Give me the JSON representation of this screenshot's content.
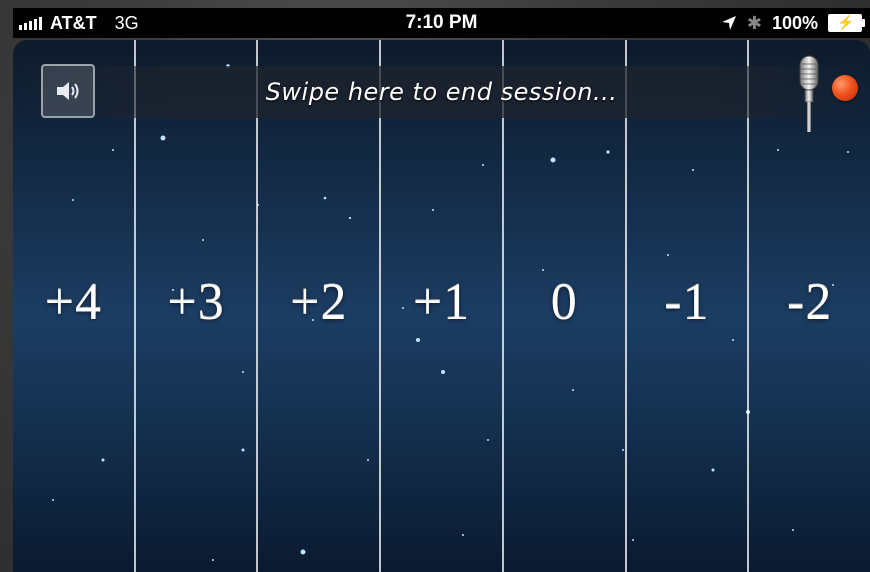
{
  "status_bar": {
    "carrier": "AT&T",
    "network": "3G",
    "time": "7:10 PM",
    "battery": "100%"
  },
  "header": {
    "swipe_text": "Swipe here to end session..."
  },
  "columns": [
    {
      "label": "+4"
    },
    {
      "label": "+3"
    },
    {
      "label": "+2"
    },
    {
      "label": "+1"
    },
    {
      "label": "0"
    },
    {
      "label": "-1"
    },
    {
      "label": "-2"
    }
  ],
  "icons": {
    "sound": "speaker-icon",
    "microphone": "microphone-icon",
    "record": "record-indicator"
  },
  "colors": {
    "record_dot": "#f0521c",
    "background_top": "#0d1a2b",
    "background_mid": "#1c3d63"
  }
}
